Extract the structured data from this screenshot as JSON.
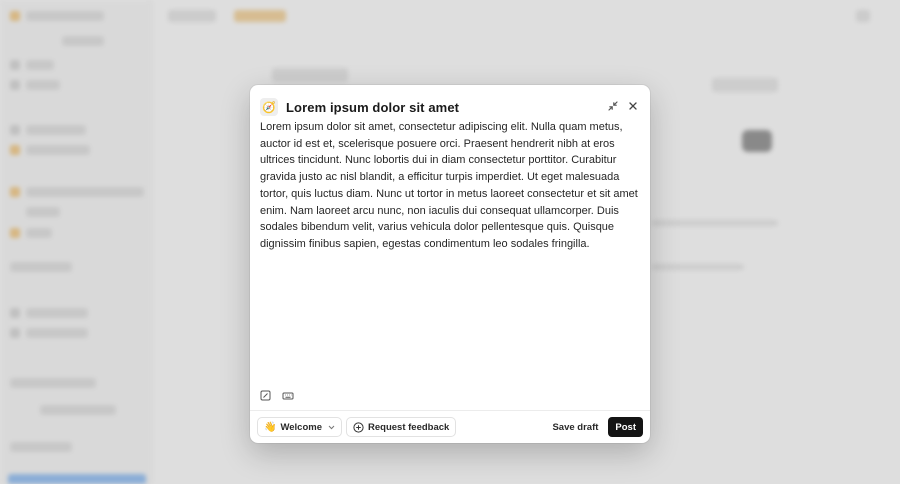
{
  "modal": {
    "channel_emoji": "🧭",
    "title": "Lorem ipsum dolor sit amet",
    "body": "Lorem ipsum dolor sit amet, consectetur adipiscing elit. Nulla quam metus, auctor id est et, scelerisque posuere orci. Praesent hendrerit nibh at eros ultrices tincidunt. Nunc lobortis dui in diam consectetur porttitor. Curabitur gravida justo ac nisl blandit, a efficitur turpis imperdiet. Ut eget malesuada tortor, quis luctus diam. Nunc ut tortor in metus laoreet consectetur et sit amet enim. Nam laoreet arcu nunc, non iaculis dui consequat ullamcorper. Duis sodales bibendum velit, varius vehicula dolor pellentesque quis. Quisque dignissim finibus sapien, egestas condimentum leo sodales fringilla."
  },
  "footer": {
    "channel_emoji": "👋",
    "channel_label": "Welcome",
    "request_feedback_label": "Request feedback",
    "save_draft_label": "Save draft",
    "post_label": "Post"
  },
  "colors": {
    "post_bg": "#141414",
    "accent_blue": "#4c93e6",
    "accent_orange": "#e6a53a"
  }
}
